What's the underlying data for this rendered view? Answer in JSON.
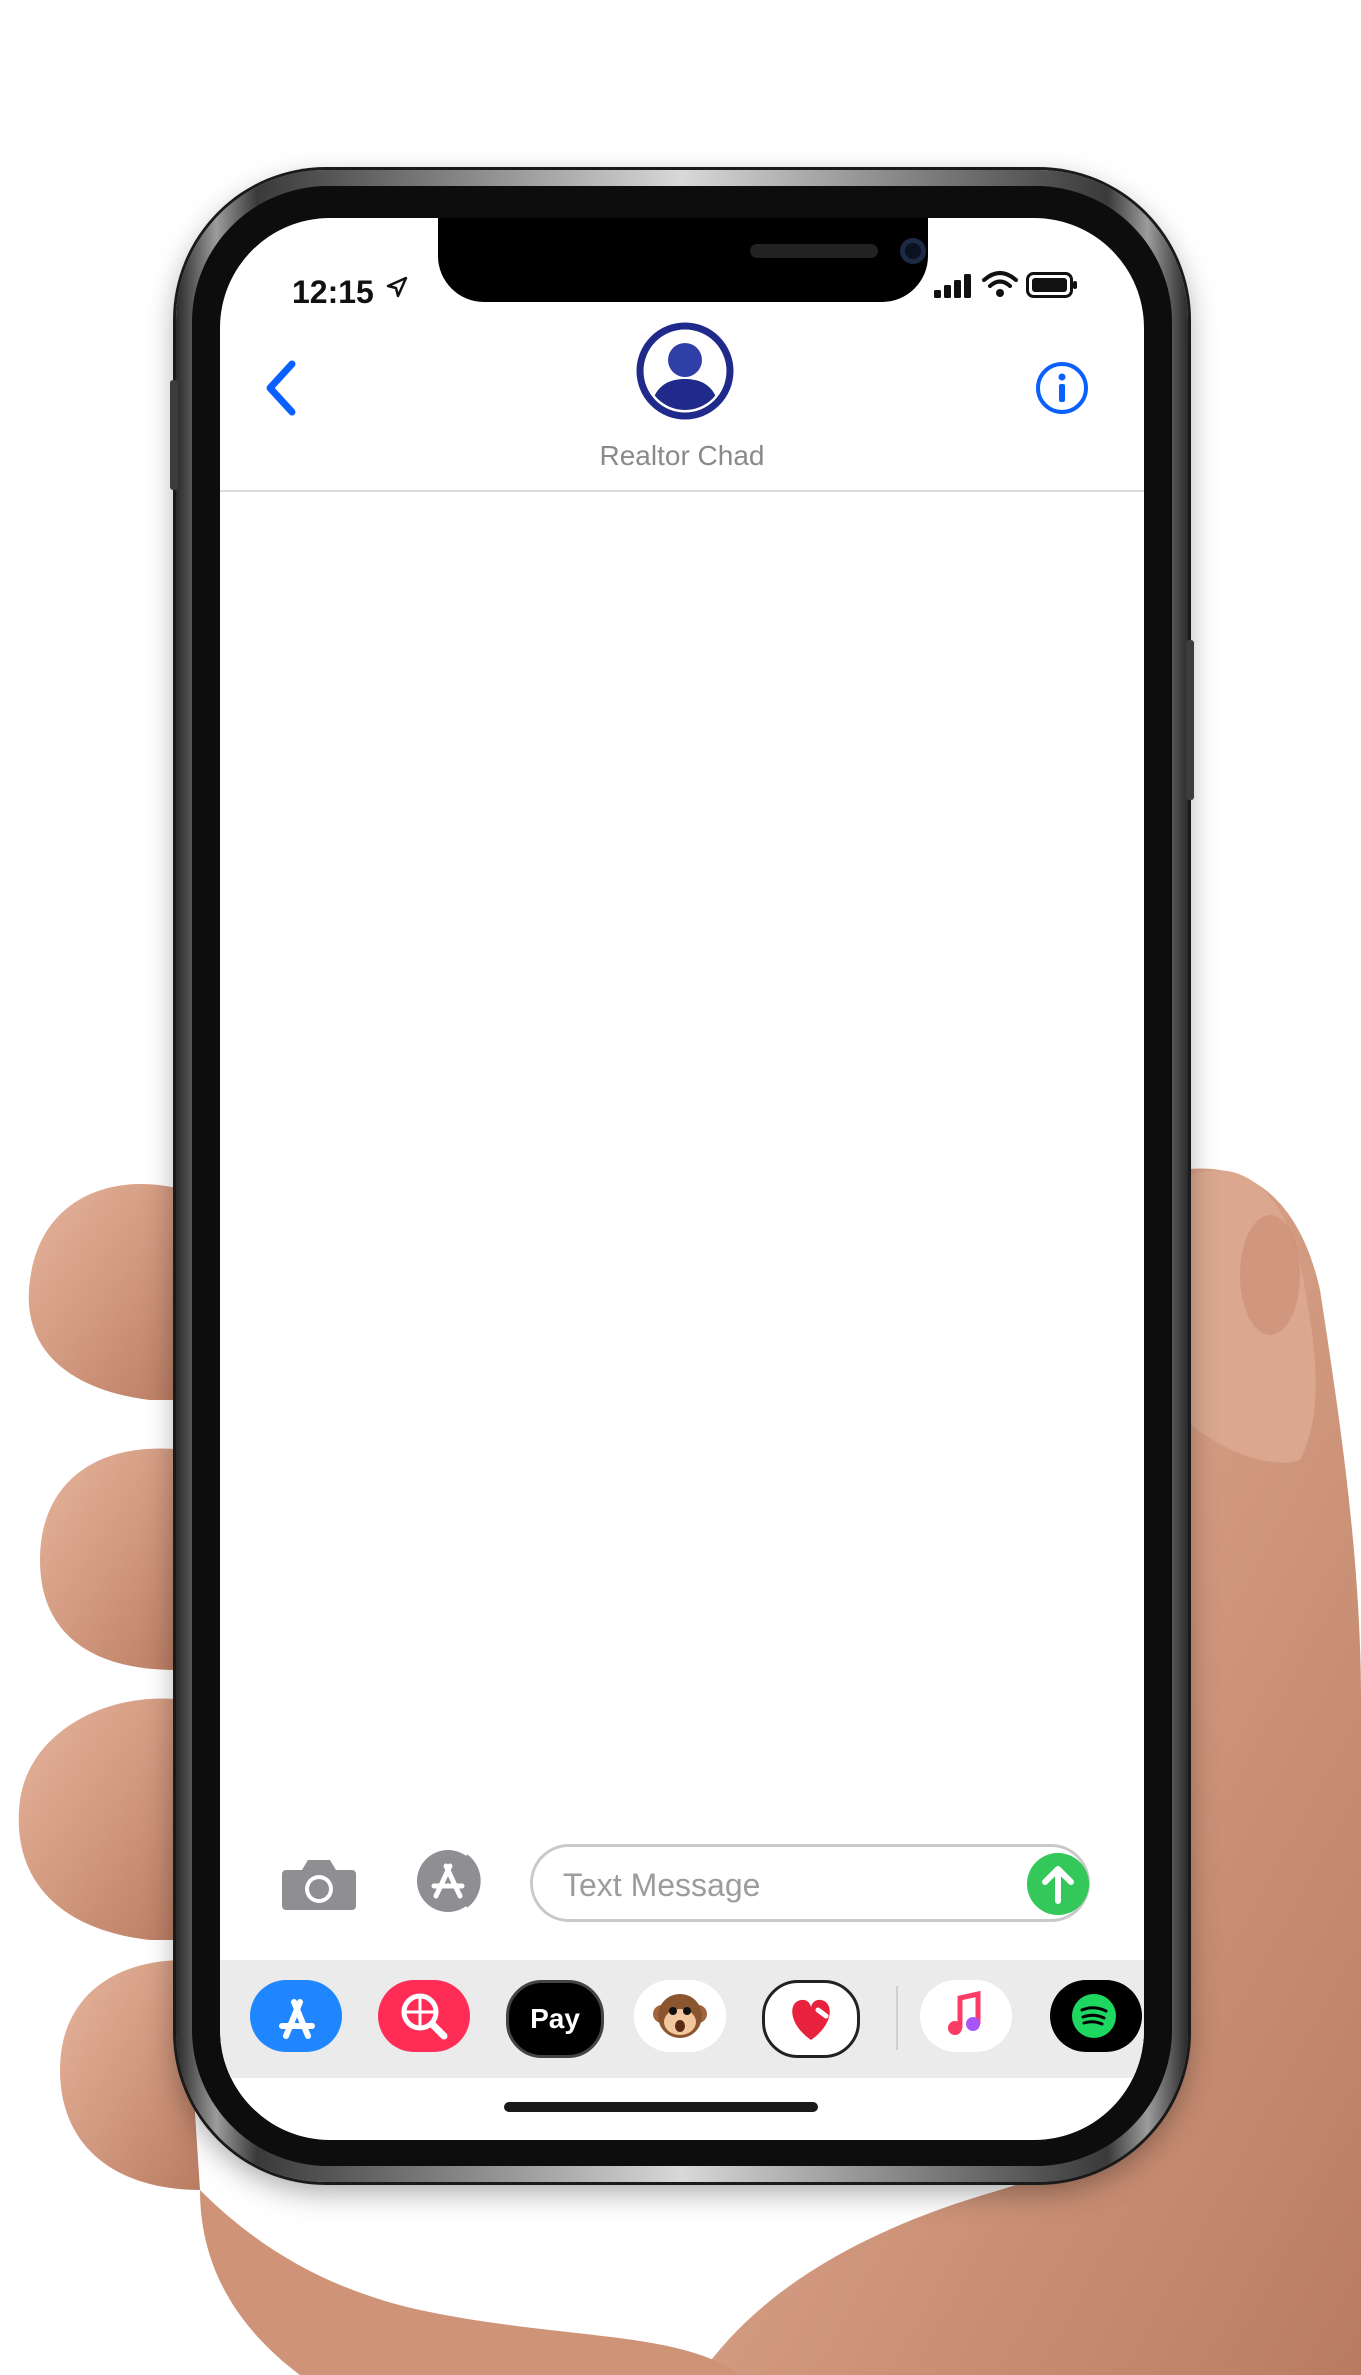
{
  "status_bar": {
    "time": "12:15"
  },
  "header": {
    "contact_name": "Realtor Chad"
  },
  "composer": {
    "placeholder": "Text Message"
  },
  "app_drawer": {
    "apps": [
      {
        "name": "app-store"
      },
      {
        "name": "web-search"
      },
      {
        "name": "apple-pay"
      },
      {
        "name": "animoji"
      },
      {
        "name": "digital-touch"
      },
      {
        "name": "music"
      },
      {
        "name": "spotify"
      }
    ],
    "apple_pay_label": "Pay"
  },
  "colors": {
    "ios_blue": "#0a60ff",
    "send_green": "#34c759",
    "contact_navy": "#1f2a8a",
    "search_pink": "#ff2d55"
  }
}
